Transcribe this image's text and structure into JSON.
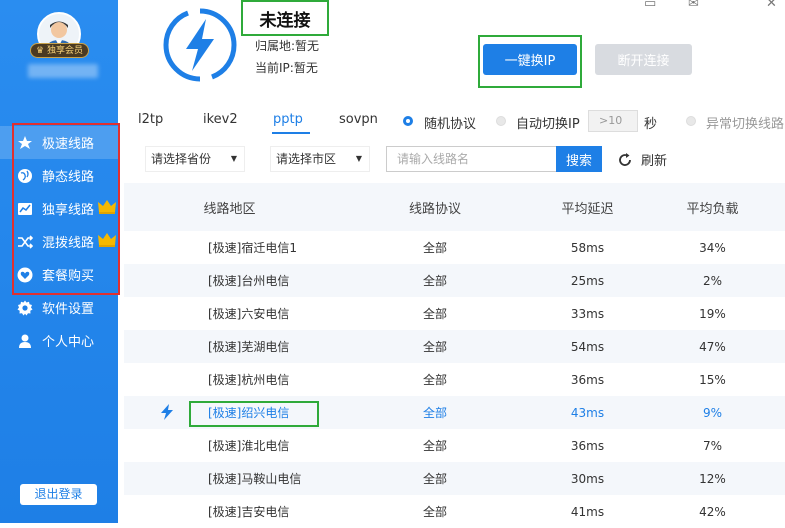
{
  "colors": {
    "brand": "#1e7fe6",
    "highlight_green": "#2faa3a",
    "highlight_red": "#e03030",
    "disabled": "#d8dbe0"
  },
  "sidebar": {
    "badge": "独享会员",
    "items": [
      {
        "label": "极速线路",
        "icon": "speed-icon",
        "active": true
      },
      {
        "label": "静态线路",
        "icon": "globe-icon"
      },
      {
        "label": "独享线路",
        "icon": "chart-icon",
        "crown": true
      },
      {
        "label": "混拨线路",
        "icon": "shuffle-icon",
        "crown": true
      },
      {
        "label": "套餐购买",
        "icon": "heart-icon"
      },
      {
        "label": "软件设置",
        "icon": "gear-icon"
      },
      {
        "label": "个人中心",
        "icon": "user-icon"
      }
    ],
    "logout": "退出登录"
  },
  "header": {
    "status": "未连接",
    "location_label": "归属地:",
    "location_value": "暂无",
    "ip_label": "当前IP:",
    "ip_value": "暂无",
    "onekey_button": "一键换IP",
    "disconnect_button": "断开连接"
  },
  "protocols": {
    "tabs": [
      "l2tp",
      "ikev2",
      "pptp",
      "sovpn"
    ],
    "active_tab": "pptp",
    "random_protocol": "随机协议",
    "auto_switch": "自动切换IP",
    "interval_placeholder": ">10",
    "seconds": "秒",
    "abnormal_switch": "异常切换线路"
  },
  "filters": {
    "province": "请选择省份",
    "city": "请选择市区",
    "search_placeholder": "请输入线路名",
    "search_button": "搜索",
    "refresh": "刷新"
  },
  "table": {
    "headers": [
      "线路地区",
      "线路协议",
      "平均延迟",
      "平均负载"
    ],
    "rows": [
      [
        "[极速]宿迁电信1",
        "全部",
        "58ms",
        "34%"
      ],
      [
        "[极速]台州电信",
        "全部",
        "25ms",
        "2%"
      ],
      [
        "[极速]六安电信",
        "全部",
        "33ms",
        "19%"
      ],
      [
        "[极速]芜湖电信",
        "全部",
        "54ms",
        "47%"
      ],
      [
        "[极速]杭州电信",
        "全部",
        "36ms",
        "15%"
      ],
      [
        "[极速]绍兴电信",
        "全部",
        "43ms",
        "9%"
      ],
      [
        "[极速]淮北电信",
        "全部",
        "36ms",
        "7%"
      ],
      [
        "[极速]马鞍山电信",
        "全部",
        "30ms",
        "12%"
      ],
      [
        "[极速]吉安电信",
        "全部",
        "41ms",
        "42%"
      ]
    ],
    "selected_row": 5
  }
}
